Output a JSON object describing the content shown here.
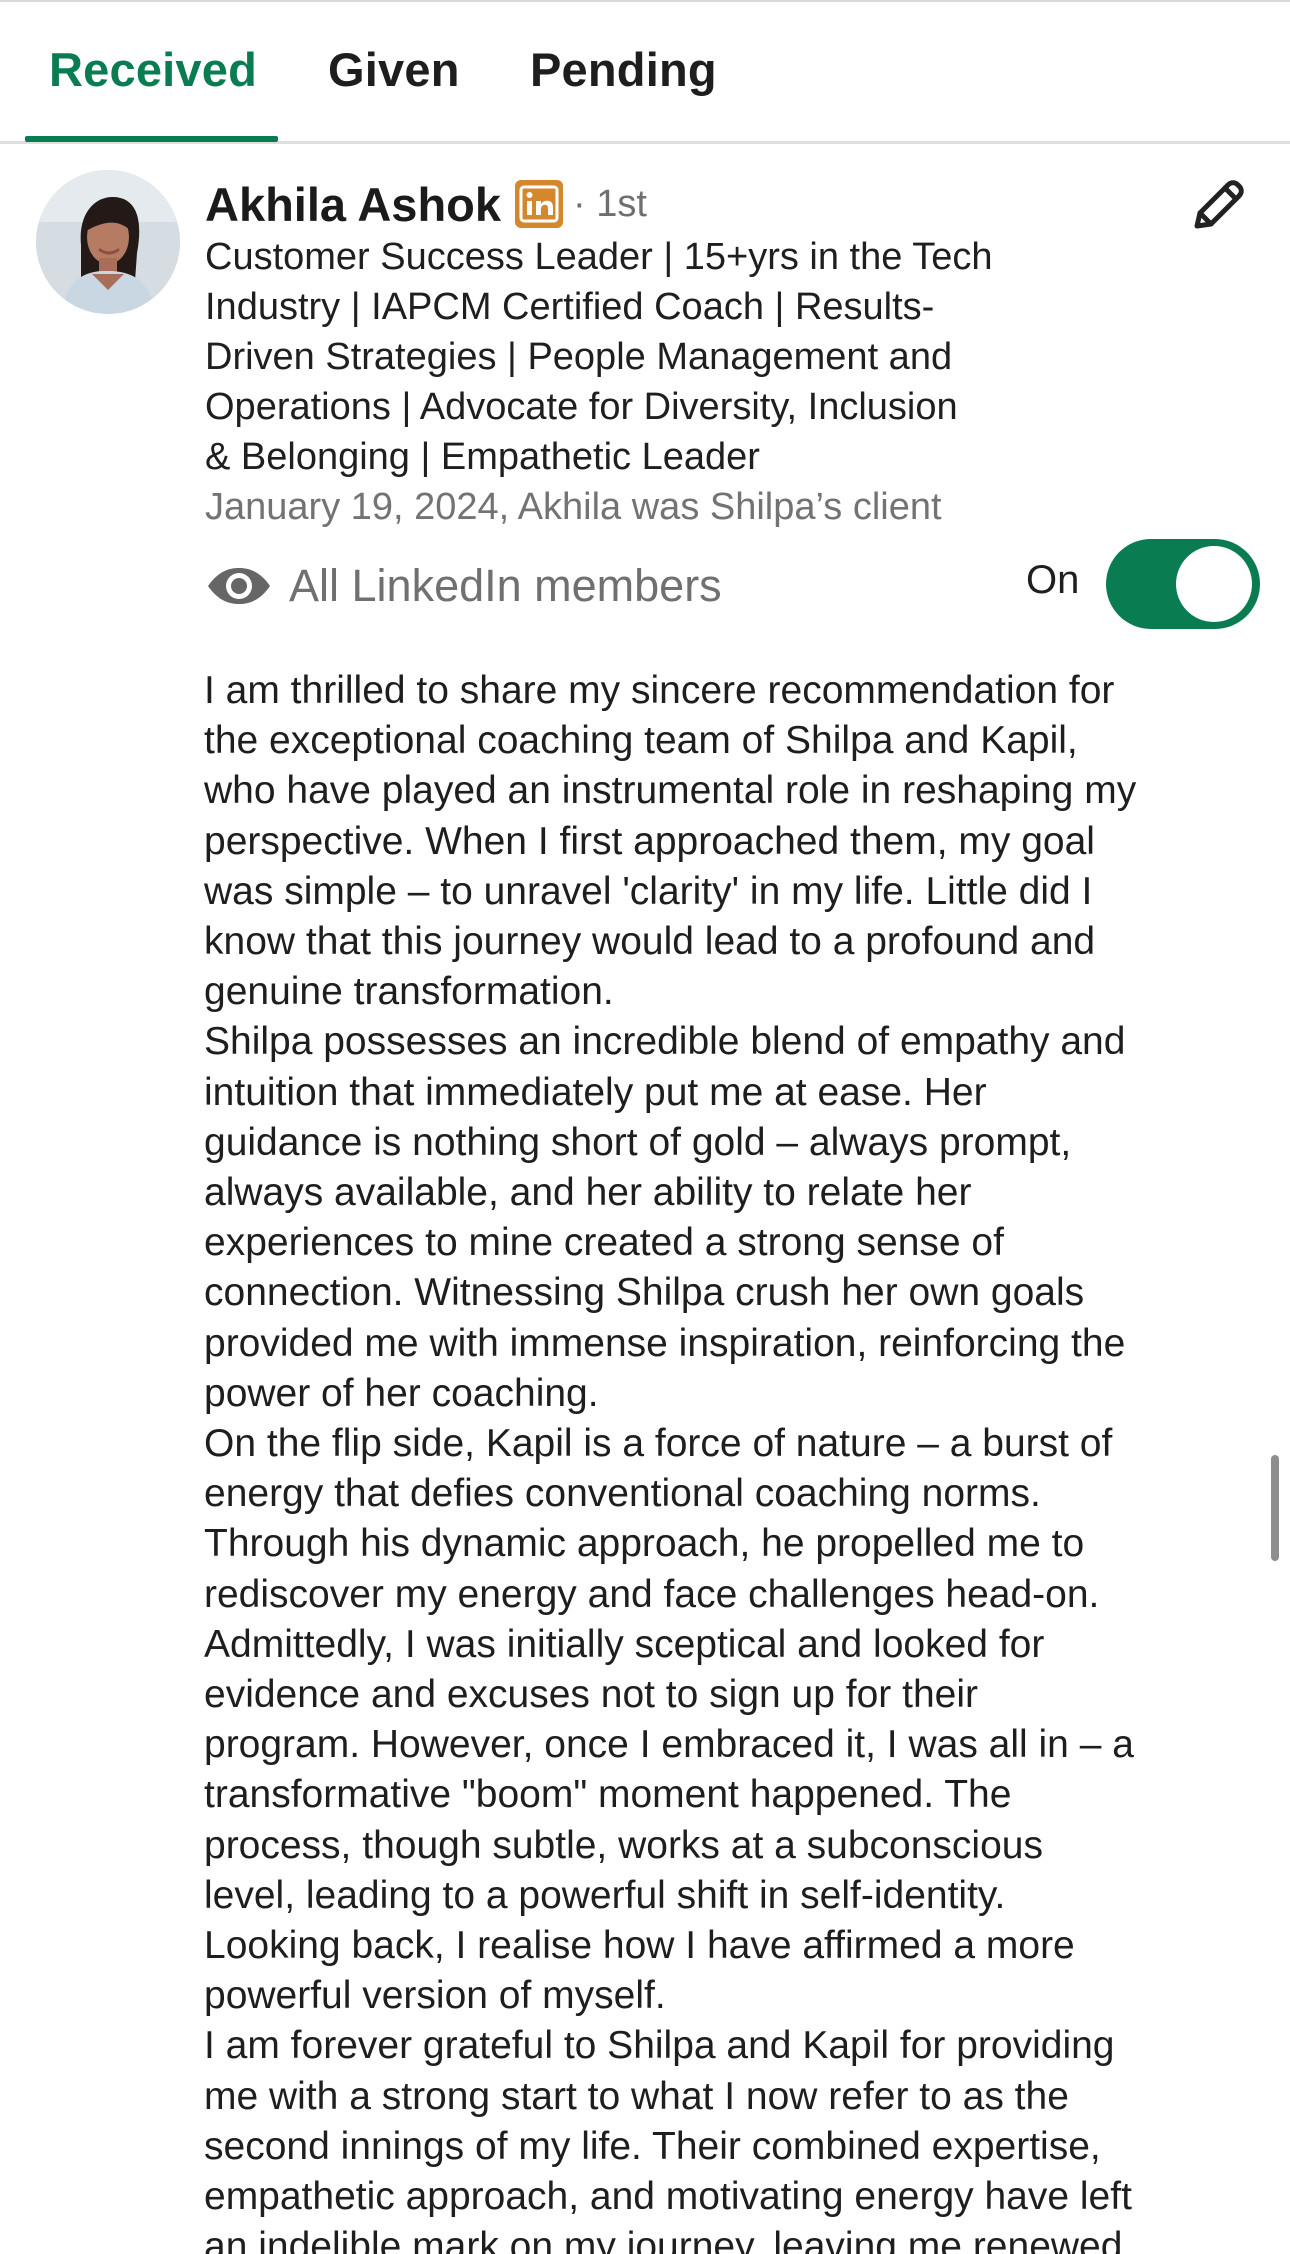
{
  "tabs": [
    {
      "label": "Received",
      "active": true
    },
    {
      "label": "Given",
      "active": false
    },
    {
      "label": "Pending",
      "active": false
    }
  ],
  "recommendation": {
    "recommender": {
      "name": "Akhila Ashok",
      "badge": "in",
      "degree": "· 1st",
      "headline_lines": [
        "Customer Success Leader | 15+yrs in the Tech",
        "Industry | IAPCM Certified Coach | Results-",
        "Driven Strategies | People Management and",
        "Operations | Advocate for Diversity, Inclusion",
        "& Belonging | Empathetic Leader"
      ],
      "meta": "January 19, 2024, Akhila was Shilpa’s client"
    },
    "visibility": {
      "audience": "All LinkedIn members",
      "toggle_label": "On",
      "toggle_state": true
    },
    "body_lines": [
      "I am thrilled to share my sincere recommendation for",
      "the exceptional coaching team of Shilpa and Kapil,",
      "who have played an instrumental role in reshaping my",
      "perspective. When I first approached them, my goal",
      "was simple – to unravel 'clarity' in my life. Little did I",
      "know that this journey would lead to a profound and",
      "genuine transformation.",
      "Shilpa possesses an incredible blend of empathy and",
      "intuition that immediately put me at ease. Her",
      "guidance is nothing short of gold – always prompt,",
      "always available, and her ability to relate her",
      "experiences to mine created a strong sense of",
      "connection. Witnessing Shilpa crush her own goals",
      "provided me with immense inspiration, reinforcing the",
      "power of her coaching.",
      "On the flip side, Kapil is a force of nature – a burst of",
      "energy that defies conventional coaching norms.",
      "Through his dynamic approach, he propelled me to",
      "rediscover my energy and face challenges head-on.",
      "Admittedly, I was initially sceptical and looked for",
      "evidence and excuses not to sign up for their",
      "program. However, once I embraced it, I was all in – a",
      "transformative \"boom\" moment happened. The",
      "process, though subtle, works at a subconscious",
      "level, leading to a powerful shift in self-identity.",
      "Looking back, I realise how I have affirmed a more",
      "powerful version of myself.",
      "I am forever grateful to Shilpa and Kapil for providing",
      "me with a strong start to what I now refer to as the",
      "second innings of my life. Their combined expertise,",
      "empathetic approach, and motivating energy have left",
      "an indelible mark on my journey, leaving me renewed"
    ]
  },
  "colors": {
    "accent": "#0a7c52",
    "linkedin_badge": "#d4872c",
    "muted_text": "#737373"
  },
  "icons": {
    "edit": "pencil-icon",
    "visibility": "eye-icon",
    "badge": "linkedin-icon"
  }
}
